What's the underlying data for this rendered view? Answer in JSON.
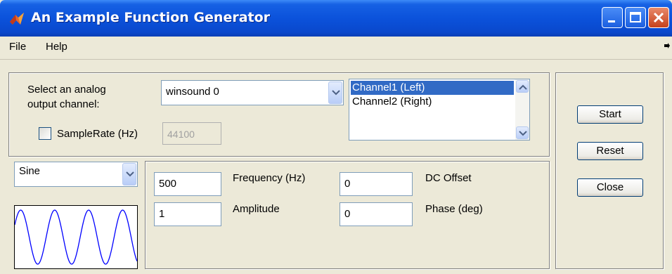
{
  "window": {
    "title": "An Example Function Generator"
  },
  "menu": {
    "file": "File",
    "help": "Help"
  },
  "channel": {
    "select_label_line1": "Select an analog",
    "select_label_line2": "output channel:",
    "device_dropdown": "winsound 0",
    "samplerate_checkbox_label": "SampleRate (Hz)",
    "samplerate_checked": false,
    "samplerate_value": "44100",
    "channels": [
      "Channel1 (Left)",
      "Channel2 (Right)"
    ],
    "selected_channel_index": 0
  },
  "waveform": {
    "type": "Sine"
  },
  "params": {
    "frequency_value": "500",
    "frequency_label": "Frequency (Hz)",
    "dc_offset_value": "0",
    "dc_offset_label": "DC Offset",
    "amplitude_value": "1",
    "amplitude_label": "Amplitude",
    "phase_value": "0",
    "phase_label": "Phase (deg)"
  },
  "buttons": {
    "start": "Start",
    "reset": "Reset",
    "close": "Close"
  },
  "colors": {
    "titlebar": "#0a48cc",
    "selection": "#316ac5",
    "waveform_line": "#0000ff",
    "close_button": "#c5411c"
  }
}
